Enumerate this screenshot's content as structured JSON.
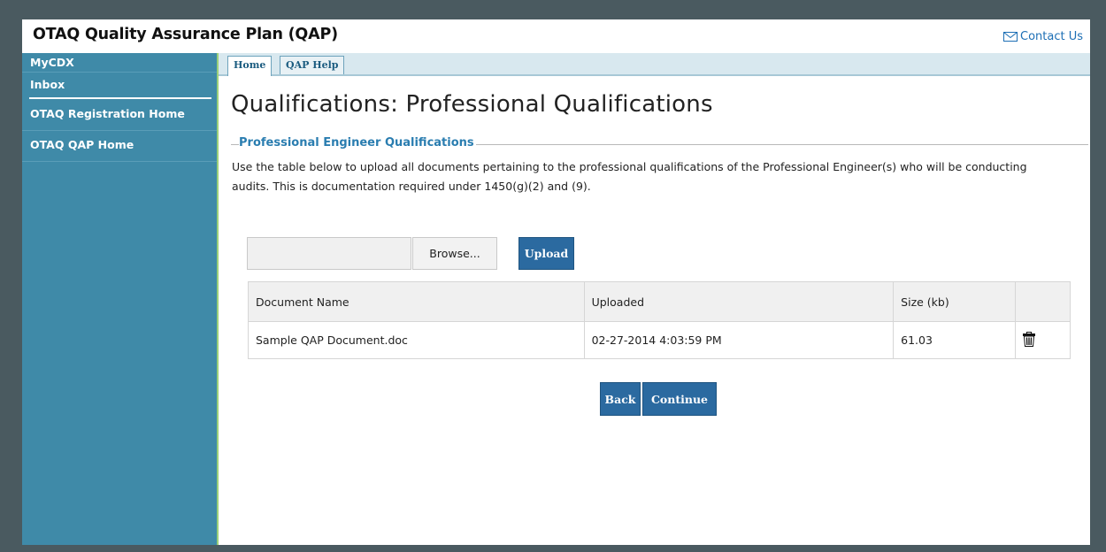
{
  "app": {
    "title": "OTAQ Quality Assurance Plan (QAP)",
    "contact_label": "Contact Us"
  },
  "sidebar": {
    "items": [
      {
        "label": "MyCDX"
      },
      {
        "label": "Inbox"
      },
      {
        "label": "OTAQ Registration Home"
      },
      {
        "label": "OTAQ QAP Home"
      }
    ]
  },
  "tabs": [
    {
      "label": "Home",
      "active": true
    },
    {
      "label": "QAP Help",
      "active": false
    }
  ],
  "page": {
    "title": "Qualifications: Professional Qualifications",
    "section_label": "Professional Engineer Qualifications",
    "description": "Use the table below to upload all documents pertaining to the professional qualifications of the Professional Engineer(s) who will be conducting audits. This is documentation required under 1450(g)(2) and (9)."
  },
  "upload": {
    "file_value": "",
    "browse_label": "Browse...",
    "upload_label": "Upload"
  },
  "table": {
    "headers": [
      "Document Name",
      "Uploaded",
      "Size (kb)",
      ""
    ],
    "rows": [
      {
        "name": "Sample QAP Document.doc",
        "uploaded": "02-27-2014 4:03:59 PM",
        "size": "61.03",
        "action_icon": "trash-icon"
      }
    ]
  },
  "actions": {
    "back_label": "Back",
    "continue_label": "Continue"
  },
  "colors": {
    "sidebar": "#3f8aa8",
    "button": "#2b6aa0",
    "section_label": "#2a7db0",
    "link": "#1d6fb5"
  }
}
